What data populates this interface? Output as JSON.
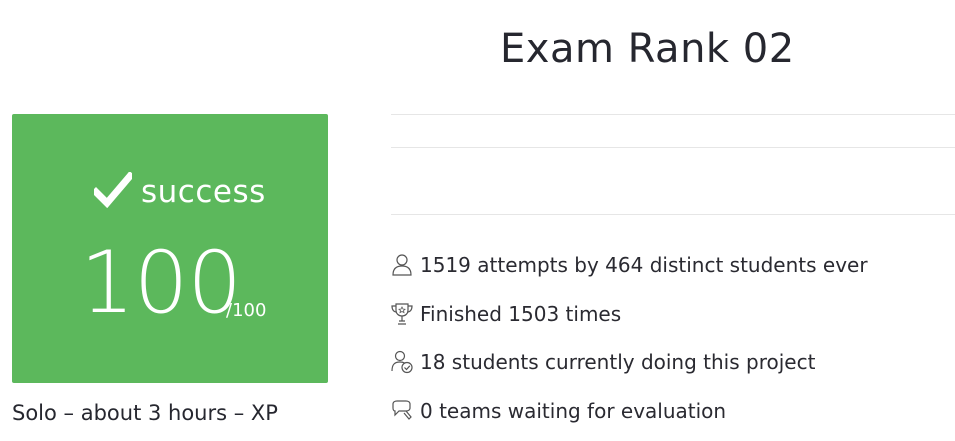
{
  "project": {
    "title": "Exam Rank 02"
  },
  "result": {
    "status_label": "success",
    "status_color": "#5cb85c",
    "score": "100",
    "max_score": "/100"
  },
  "meta": {
    "text": "Solo – about 3 hours – XP"
  },
  "stats": {
    "attempts": {
      "icon": "user-icon",
      "text": "1519 attempts by 464 distinct students ever"
    },
    "finished": {
      "icon": "trophy-icon",
      "text": "Finished 1503 times"
    },
    "current": {
      "icon": "user-check-icon",
      "text": "18 students currently doing this project"
    },
    "waiting": {
      "icon": "chat-bubbles-icon",
      "text": "0 teams waiting for evaluation"
    }
  }
}
